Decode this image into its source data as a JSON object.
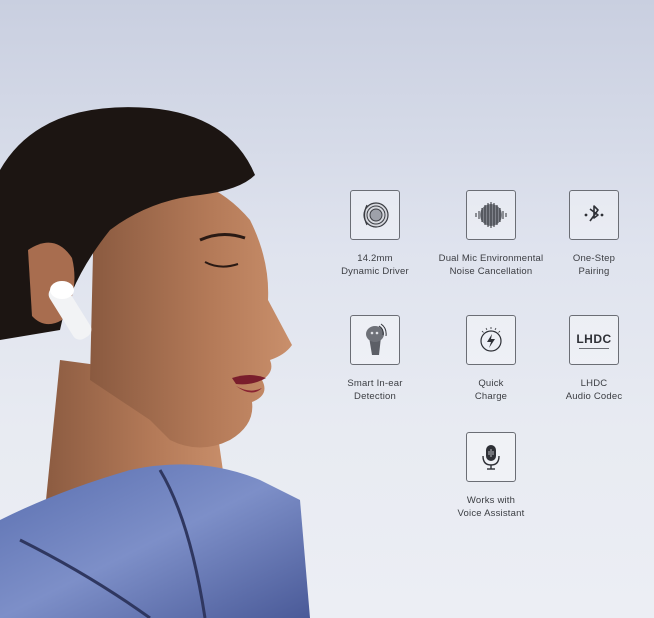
{
  "features": [
    {
      "id": "driver",
      "icon": "speaker-driver-icon",
      "line1": "14.2mm",
      "line2": "Dynamic Driver"
    },
    {
      "id": "noise",
      "icon": "sound-wave-icon",
      "line1": "Dual Mic Environmental",
      "line2": "Noise Cancellation"
    },
    {
      "id": "pairing",
      "icon": "bluetooth-icon",
      "line1": "One-Step",
      "line2": "Pairing"
    },
    {
      "id": "inear",
      "icon": "earbud-icon",
      "line1": "Smart In-ear",
      "line2": "Detection"
    },
    {
      "id": "charge",
      "icon": "lightning-charge-icon",
      "line1": "Quick",
      "line2": "Charge"
    },
    {
      "id": "lhdc",
      "icon": "lhdc-logo-icon",
      "logo_text": "LHDC",
      "line1": "LHDC",
      "line2": "Audio Codec"
    },
    {
      "id": "voice",
      "icon": "microphone-icon",
      "line1": "Works with",
      "line2": "Voice Assistant"
    }
  ]
}
